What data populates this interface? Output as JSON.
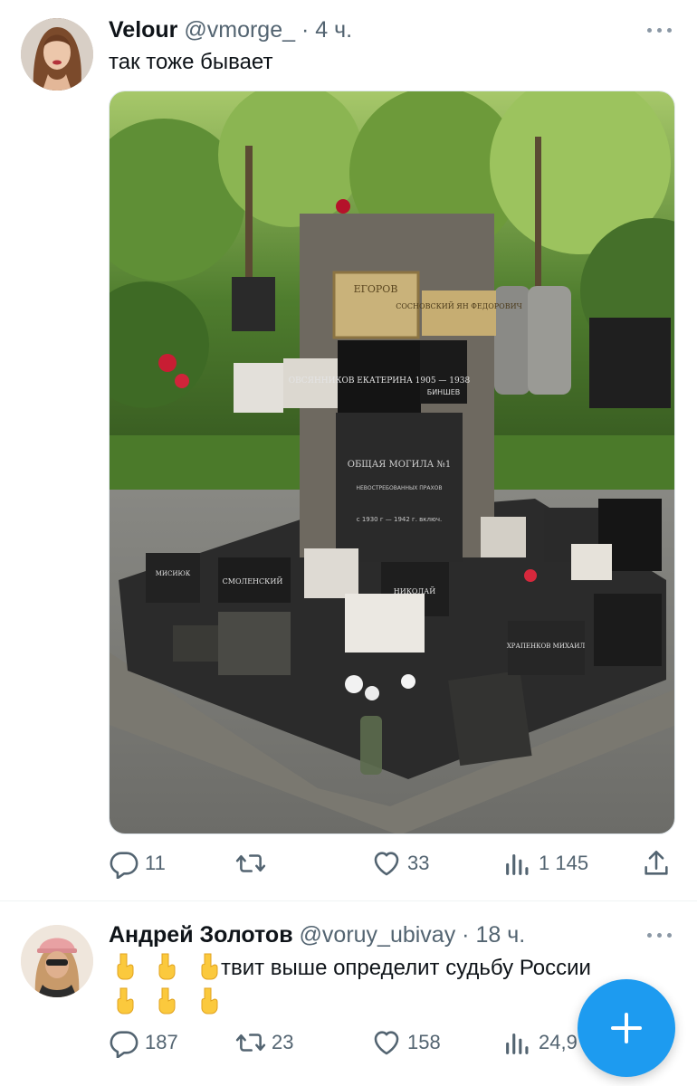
{
  "tweets": [
    {
      "name": "Velour",
      "handle": "@vmorge_",
      "time": "4 ч.",
      "text": "так тоже бывает",
      "image": {
        "plaques": [
          "ЕГОРОВ",
          "СОСНОВСКИЙ ЯН ФЕДОРОВИЧ",
          "ОВСЯННИКОВ ЕКАТЕРИНА 1905 — 1938",
          "БИНШЕВ",
          "ОБЩАЯ МОГИЛА №1",
          "НЕВОСТРЕБОВАННЫХ ПРАХОВ",
          "с 1930 г — 1942 г. включ.",
          "СМОЛЕНСКИЙ",
          "МИСИЮК",
          "НИКОЛАЙ",
          "ХРАПЕНКОВ МИХАИЛ"
        ]
      },
      "stats": {
        "replies": "11",
        "retweets": "",
        "likes": "33",
        "views": "1 145"
      }
    },
    {
      "name": "Андрей Золотов",
      "handle": "@voruy_ubivay",
      "time": "18 ч.",
      "text": "твит выше определит судьбу России",
      "stats": {
        "replies": "187",
        "retweets": "23",
        "likes": "158",
        "views": "24,9"
      }
    }
  ],
  "icons": {
    "reply": "reply-icon",
    "retweet": "retweet-icon",
    "like": "heart-icon",
    "views": "analytics-icon",
    "share": "share-icon",
    "compose": "compose-plus-icon",
    "emoji": "backhand-index-pointing-down-emoji"
  },
  "colors": {
    "accent": "#1d9bf0",
    "secondary_text": "#536471",
    "primary_text": "#0f1419"
  }
}
